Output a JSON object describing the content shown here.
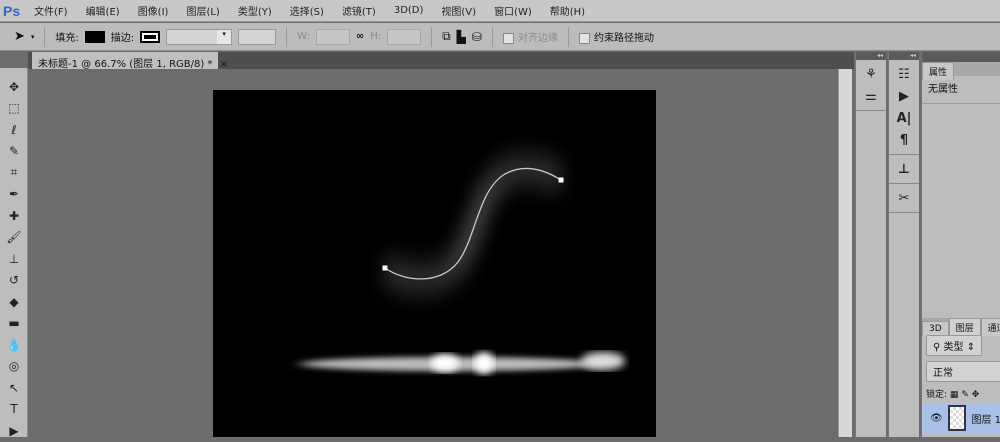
{
  "app": {
    "logo": "Ps"
  },
  "menu": [
    "文件(F)",
    "编辑(E)",
    "图像(I)",
    "图层(L)",
    "类型(Y)",
    "选择(S)",
    "滤镜(T)",
    "3D(D)",
    "视图(V)",
    "窗口(W)",
    "帮助(H)"
  ],
  "options": {
    "fill_label": "填充:",
    "stroke_label": "描边:",
    "w_label": "W:",
    "h_label": "H:",
    "align_edges": "对齐边缘",
    "constrain_path": "约束路径拖动",
    "align_checked": false,
    "constrain_checked": false
  },
  "document": {
    "tab_title": "未标题-1 @ 66.7% (图层 1, RGB/8) *",
    "close": "×"
  },
  "tools": [
    "move-icon",
    "marquee-icon",
    "lasso-icon",
    "quick-select-icon",
    "crop-icon",
    "eyedropper-icon",
    "healing-icon",
    "brush-icon",
    "stamp-icon",
    "history-brush-icon",
    "eraser-icon",
    "gradient-icon",
    "blur-icon",
    "dodge-icon",
    "pen-icon",
    "type-icon"
  ],
  "properties": {
    "tab": "属性",
    "content": "无属性"
  },
  "layers": {
    "tabs": [
      "3D",
      "图层",
      "通道"
    ],
    "filter": "类型",
    "blend_mode": "正常",
    "lock_label": "锁定:",
    "layer_name": "图层 1"
  },
  "colors": {
    "canvas": "#000000",
    "workspace": "#6c6c6c",
    "selected_layer": "#a9c0e8"
  }
}
